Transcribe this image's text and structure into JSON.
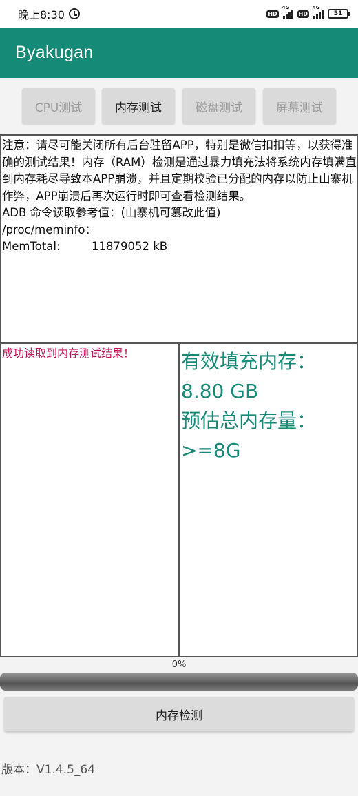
{
  "status_bar": {
    "time": "晚上8:30",
    "network_labels": [
      "HD",
      "4G",
      "HD",
      "4G"
    ],
    "battery": "51"
  },
  "app_bar": {
    "title": "Byakugan"
  },
  "tabs": [
    {
      "label": "CPU测试",
      "active": false
    },
    {
      "label": "内存测试",
      "active": true
    },
    {
      "label": "磁盘测试",
      "active": false
    },
    {
      "label": "屏幕测试",
      "active": false
    }
  ],
  "notice": {
    "text": "注意：请尽可能关闭所有后台驻留APP，特别是微信扣扣等，以获得准确的测试结果！内存（RAM）检测是通过暴力填充法将系统内存填满直到内存耗尽导致本APP崩溃，并且定期校验已分配的内存以防止山寨机作弊，APP崩溃后再次运行时即可查看检测结果。",
    "adb_line": "ADB 命令读取参考值：(山寨机可篡改此值)",
    "meminfo_path": "/proc/meminfo：",
    "mem_total_key": "MemTotal:",
    "mem_total_value": "11879052 kB"
  },
  "result_left": {
    "message": "成功读取到内存测试结果！"
  },
  "result_right": {
    "label_fill": "有效填充内存：",
    "fill_value": "8.80 GB",
    "label_total": "预估总内存量：",
    "total_value": ">=8G"
  },
  "progress": {
    "label": "0%",
    "value": 0
  },
  "detect_button": {
    "label": "内存检测"
  },
  "version": "版本：V1.4.5_64",
  "colors": {
    "primary": "#158a76",
    "accent_text": "#168a77",
    "success_msg": "#c2185b"
  }
}
